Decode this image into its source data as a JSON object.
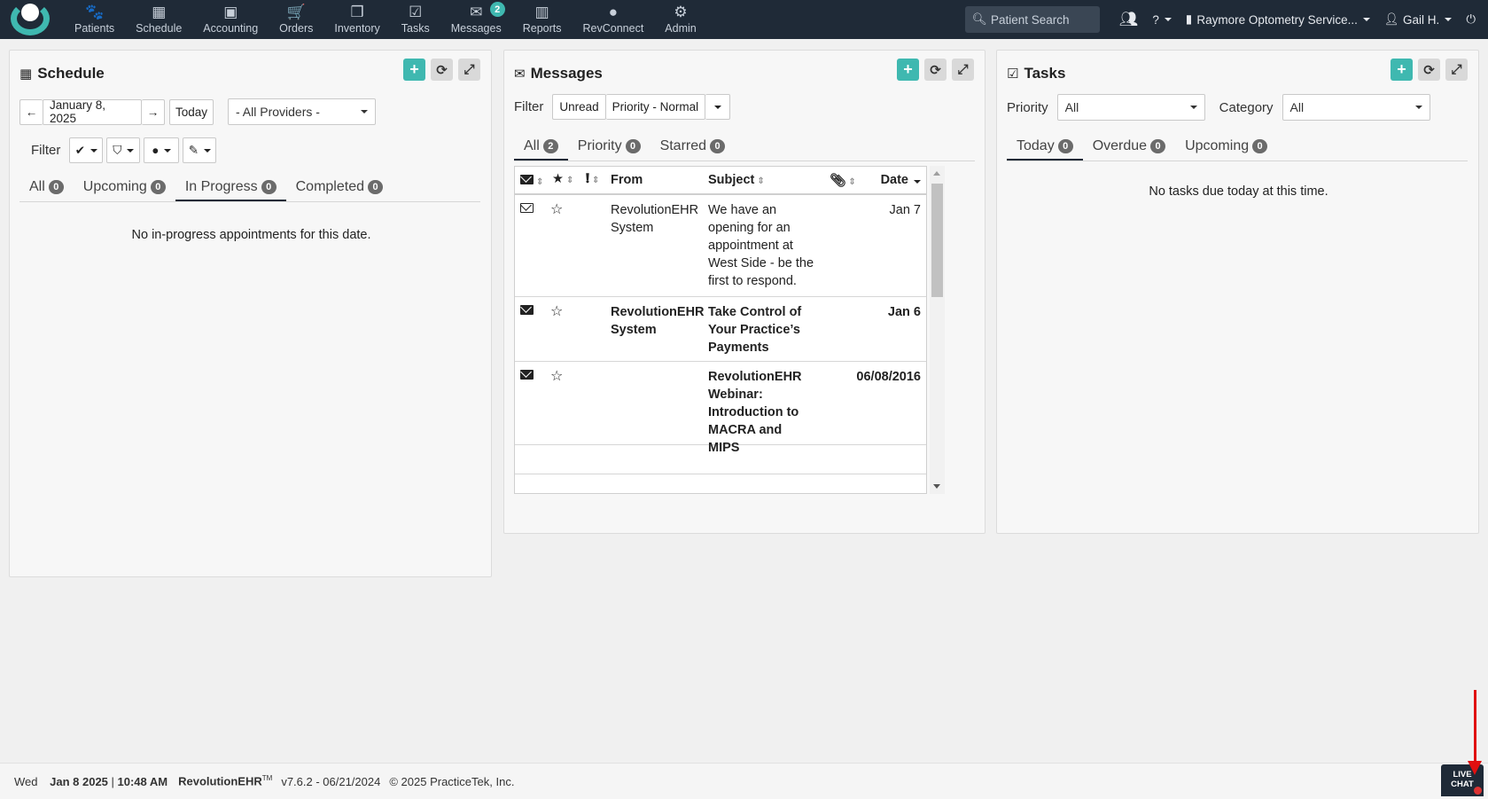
{
  "nav": {
    "items": [
      {
        "label": "Patients",
        "icon": "paw-icon",
        "glyph": "🐾"
      },
      {
        "label": "Schedule",
        "icon": "calendar-icon",
        "glyph": "▦"
      },
      {
        "label": "Accounting",
        "icon": "money-icon",
        "glyph": "▣"
      },
      {
        "label": "Orders",
        "icon": "cart-icon",
        "glyph": "🛒"
      },
      {
        "label": "Inventory",
        "icon": "cubes-icon",
        "glyph": "❒"
      },
      {
        "label": "Tasks",
        "icon": "check-square-icon",
        "glyph": "☑"
      },
      {
        "label": "Messages",
        "icon": "envelope-icon",
        "glyph": "✉",
        "badge": "2"
      },
      {
        "label": "Reports",
        "icon": "bar-chart-icon",
        "glyph": "▥"
      },
      {
        "label": "RevConnect",
        "icon": "comment-icon",
        "glyph": "●"
      },
      {
        "label": "Admin",
        "icon": "cogs-icon",
        "glyph": "⚙"
      }
    ],
    "search_placeholder": "Patient Search",
    "location": "Raymore Optometry Service...",
    "user": "Gail H."
  },
  "schedule": {
    "title": "Schedule",
    "date": "January 8, 2025",
    "today_label": "Today",
    "provider": "- All Providers -",
    "filter_label": "Filter",
    "tabs": [
      {
        "label": "All",
        "count": "0"
      },
      {
        "label": "Upcoming",
        "count": "0"
      },
      {
        "label": "In Progress",
        "count": "0"
      },
      {
        "label": "Completed",
        "count": "0"
      }
    ],
    "empty": "No in-progress appointments for this date."
  },
  "messages": {
    "title": "Messages",
    "filter_label": "Filter",
    "filter_unread": "Unread",
    "filter_priority": "Priority - Normal",
    "tabs": [
      {
        "label": "All",
        "count": "2"
      },
      {
        "label": "Priority",
        "count": "0"
      },
      {
        "label": "Starred",
        "count": "0"
      }
    ],
    "columns": {
      "from": "From",
      "subject": "Subject",
      "date": "Date"
    },
    "rows": [
      {
        "from": "RevolutionEHR System",
        "subject": "We have an opening for an appointment at West Side - be the first to respond.",
        "date": "Jan 7"
      },
      {
        "from": "RevolutionEHR System",
        "subject": "Take Control of Your Practice’s Payments",
        "date": "Jan 6"
      },
      {
        "from": "",
        "subject": "RevolutionEHR Webinar: Introduction to MACRA and MIPS",
        "date": "06/08/2016"
      }
    ]
  },
  "tasks": {
    "title": "Tasks",
    "priority_label": "Priority",
    "priority_value": "All",
    "category_label": "Category",
    "category_value": "All",
    "tabs": [
      {
        "label": "Today",
        "count": "0"
      },
      {
        "label": "Overdue",
        "count": "0"
      },
      {
        "label": "Upcoming",
        "count": "0"
      }
    ],
    "empty": "No tasks due today at this time."
  },
  "footer": {
    "day": "Wed",
    "date": "Jan 8 2025",
    "time": "10:48 AM",
    "brand": "RevolutionEHR",
    "tm": "TM",
    "version": "v7.6.2 - 06/21/2024",
    "copyright": "© 2025 PracticeTek, Inc."
  },
  "livechat": {
    "line1": "LIVE",
    "line2": "CHAT"
  },
  "colors": {
    "nav_bg": "#1f2a37",
    "accent": "#3fb8b0",
    "arrow": "#e01010"
  }
}
